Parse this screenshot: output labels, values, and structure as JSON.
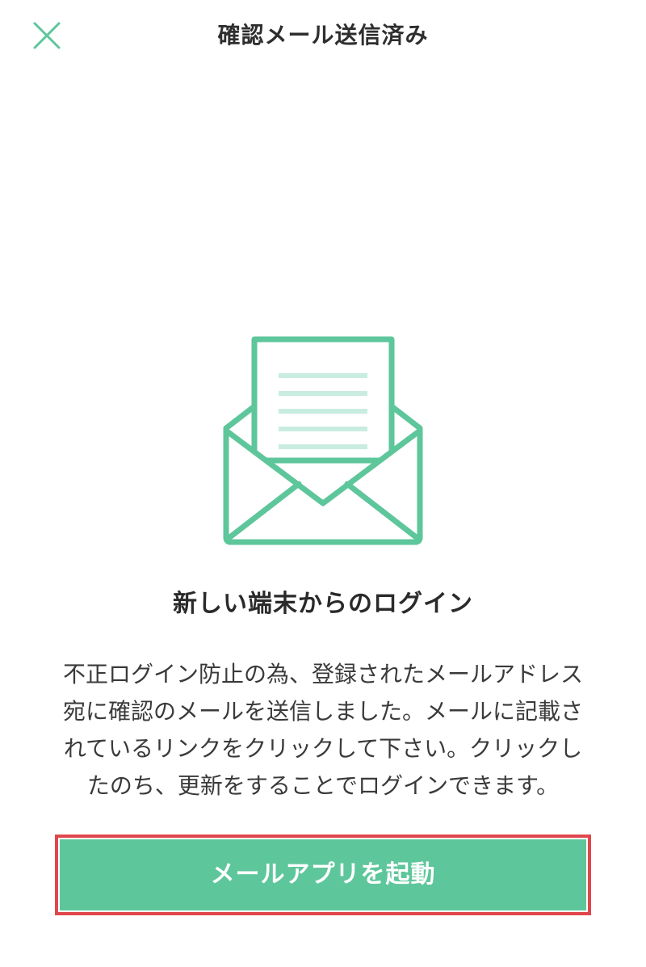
{
  "header": {
    "title": "確認メール送信済み",
    "close_icon": "close-icon"
  },
  "illustration": {
    "icon": "envelope-open-icon",
    "stroke_color": "#5ec69b",
    "line_color": "#c9ece0"
  },
  "main": {
    "heading": "新しい端末からのログイン",
    "body_lines": [
      "不正ログイン防止の為、登録されたメールアドレス",
      "宛に確認のメールを送信しました。メールに記載さ",
      "れているリンクをクリックして下さい。クリックし",
      "たのち、更新をすることでログインできます。"
    ]
  },
  "cta": {
    "label": "メールアプリを起動",
    "color": "#5ec69b",
    "highlight_color": "#e0474c"
  }
}
